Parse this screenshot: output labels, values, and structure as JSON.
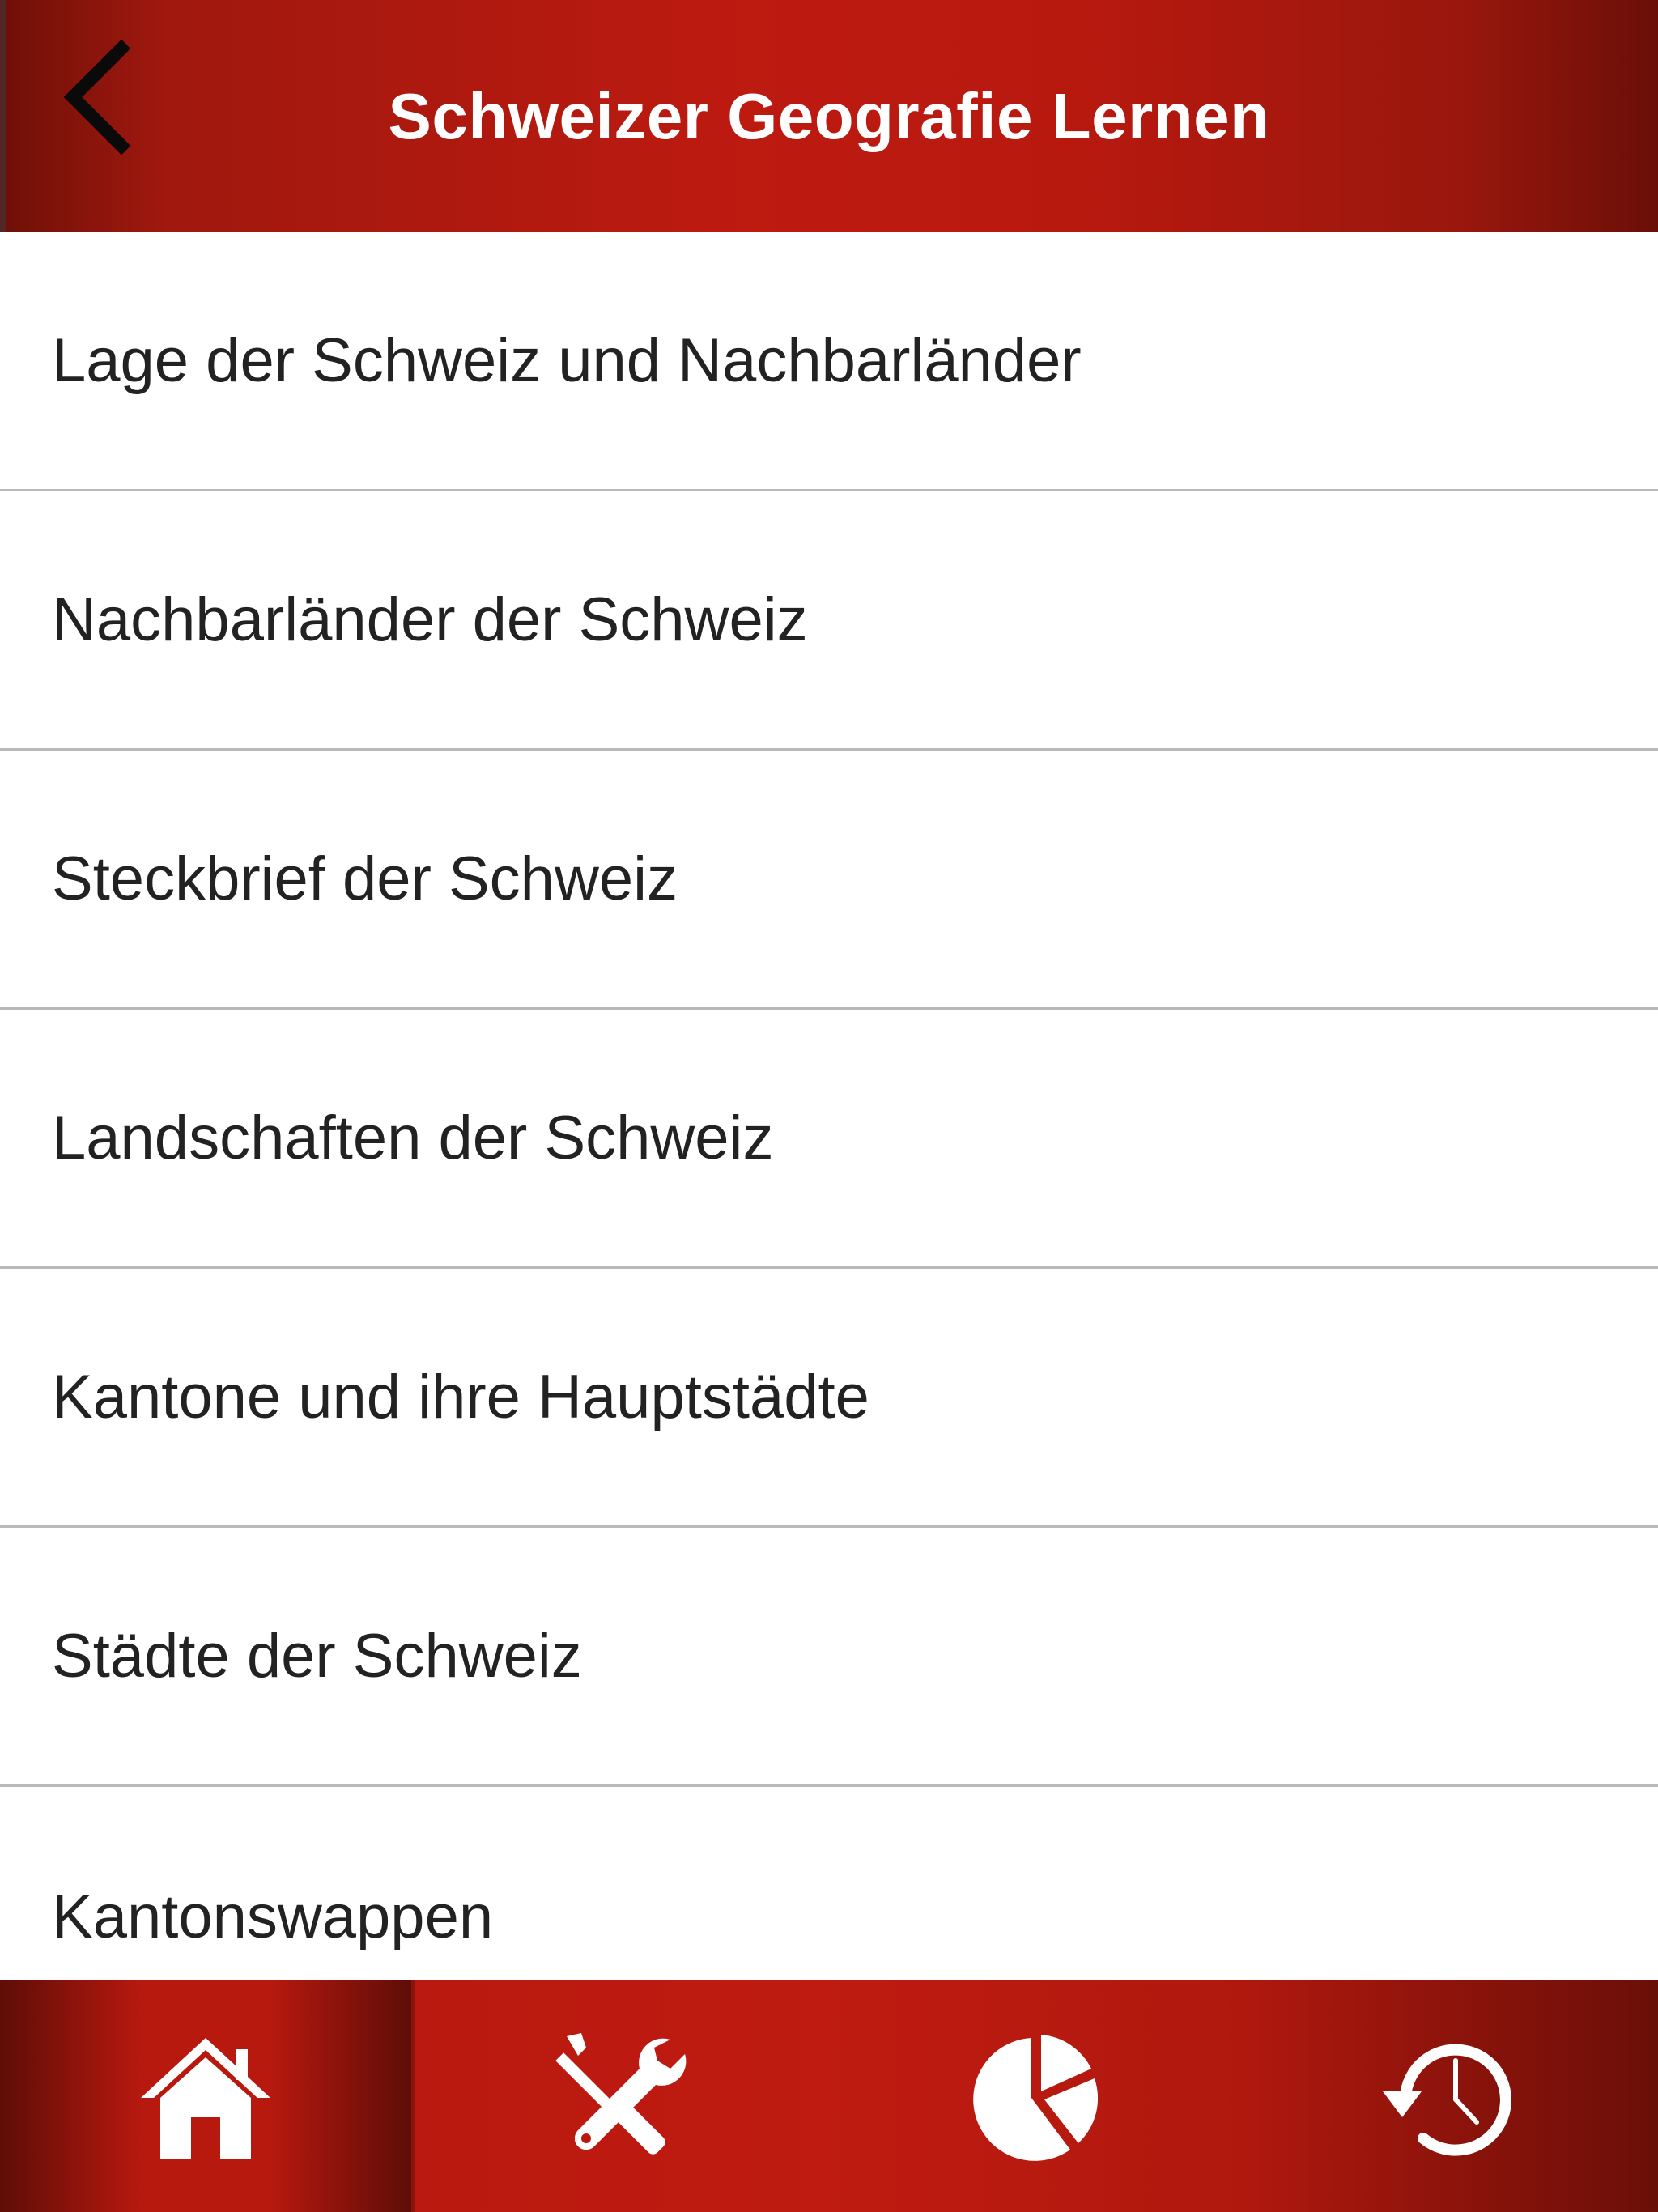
{
  "header": {
    "title": "Schweizer Geografie Lernen",
    "back_icon": "chevron-left-icon"
  },
  "menu": {
    "items": [
      {
        "label": "Lage der Schweiz und Nachbarländer"
      },
      {
        "label": "Nachbarländer der Schweiz"
      },
      {
        "label": "Steckbrief der Schweiz"
      },
      {
        "label": "Landschaften der Schweiz"
      },
      {
        "label": "Kantone und ihre Hauptstädte"
      },
      {
        "label": "Städte der Schweiz"
      },
      {
        "label": "Kantonswappen"
      }
    ]
  },
  "tabbar": {
    "tabs": [
      {
        "icon": "home-icon",
        "active": true
      },
      {
        "icon": "tools-icon",
        "active": false
      },
      {
        "icon": "pie-chart-icon",
        "active": false
      },
      {
        "icon": "history-icon",
        "active": false
      }
    ]
  },
  "colors": {
    "brand_red": "#bd1a10",
    "text_dark": "#222222",
    "separator": "#b9b9b9",
    "white": "#ffffff"
  }
}
